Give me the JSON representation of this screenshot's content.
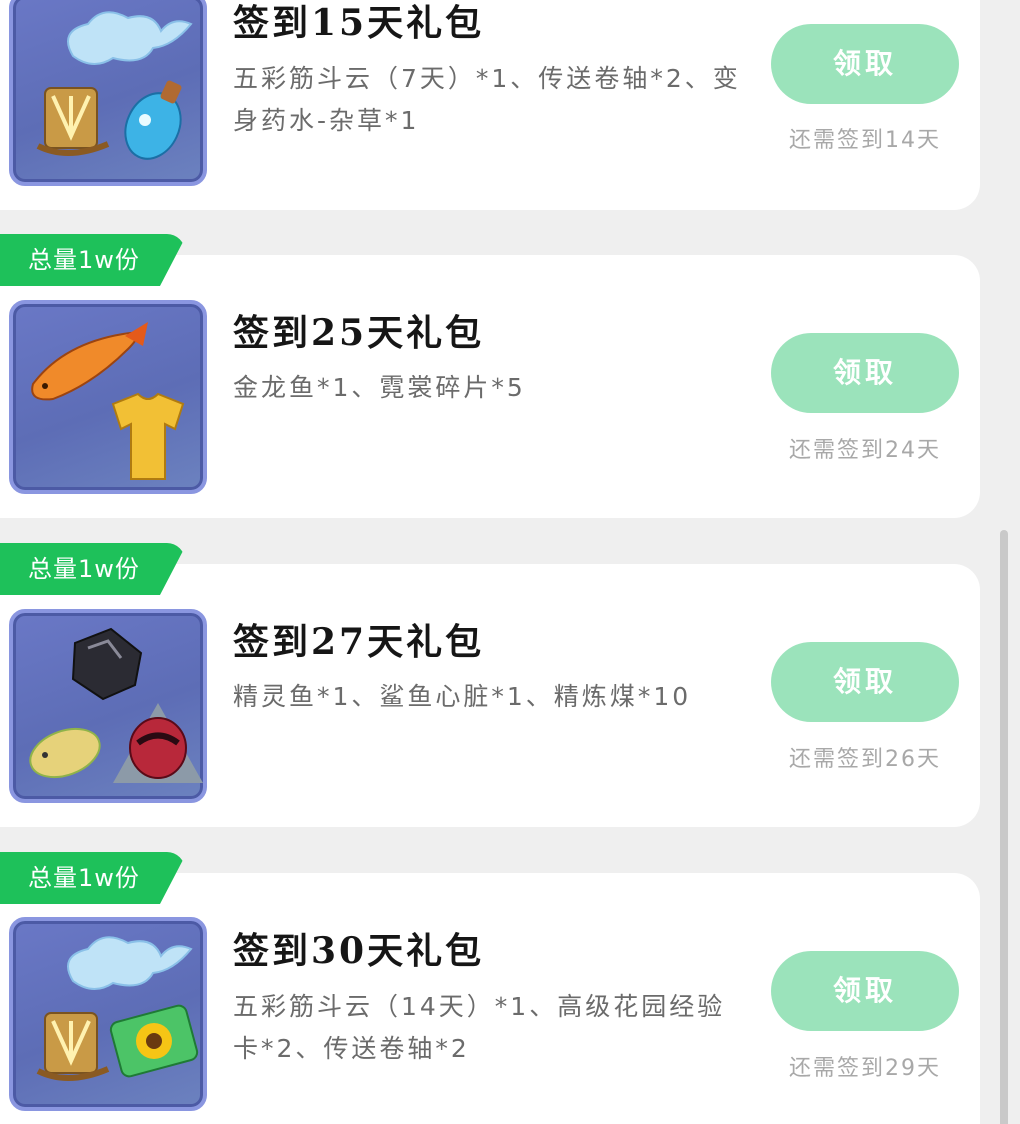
{
  "packs": [
    {
      "title": "签到15天礼包",
      "desc": "五彩筋斗云（7天）*1、传送卷轴*2、变身药水-杂草*1",
      "claim_label": "领取",
      "remain": "还需签到14天",
      "icons": [
        "cloud-icon",
        "scroll-icon",
        "potion-icon"
      ]
    },
    {
      "badge": "总量1w份",
      "title": "签到25天礼包",
      "desc": "金龙鱼*1、霓裳碎片*5",
      "claim_label": "领取",
      "remain": "还需签到24天",
      "icons": [
        "arowana-fish-icon",
        "shirt-icon"
      ]
    },
    {
      "badge": "总量1w份",
      "title": "签到27天礼包",
      "desc": "精灵鱼*1、鲨鱼心脏*1、精炼煤*10",
      "claim_label": "领取",
      "remain": "还需签到26天",
      "icons": [
        "coal-icon",
        "spirit-fish-icon",
        "shark-heart-icon"
      ]
    },
    {
      "badge": "总量1w份",
      "title": "签到30天礼包",
      "desc": "五彩筋斗云（14天）*1、高级花园经验卡*2、传送卷轴*2",
      "claim_label": "领取",
      "remain": "还需签到29天",
      "icons": [
        "cloud-icon",
        "scroll-icon",
        "sunflower-card-icon"
      ]
    }
  ],
  "colors": {
    "badge": "#1ec15a",
    "claim_button": "#9be3bb",
    "thumb_bg": "#5d6db6",
    "card_bg": "#ffffff",
    "page_bg": "#efefef"
  }
}
